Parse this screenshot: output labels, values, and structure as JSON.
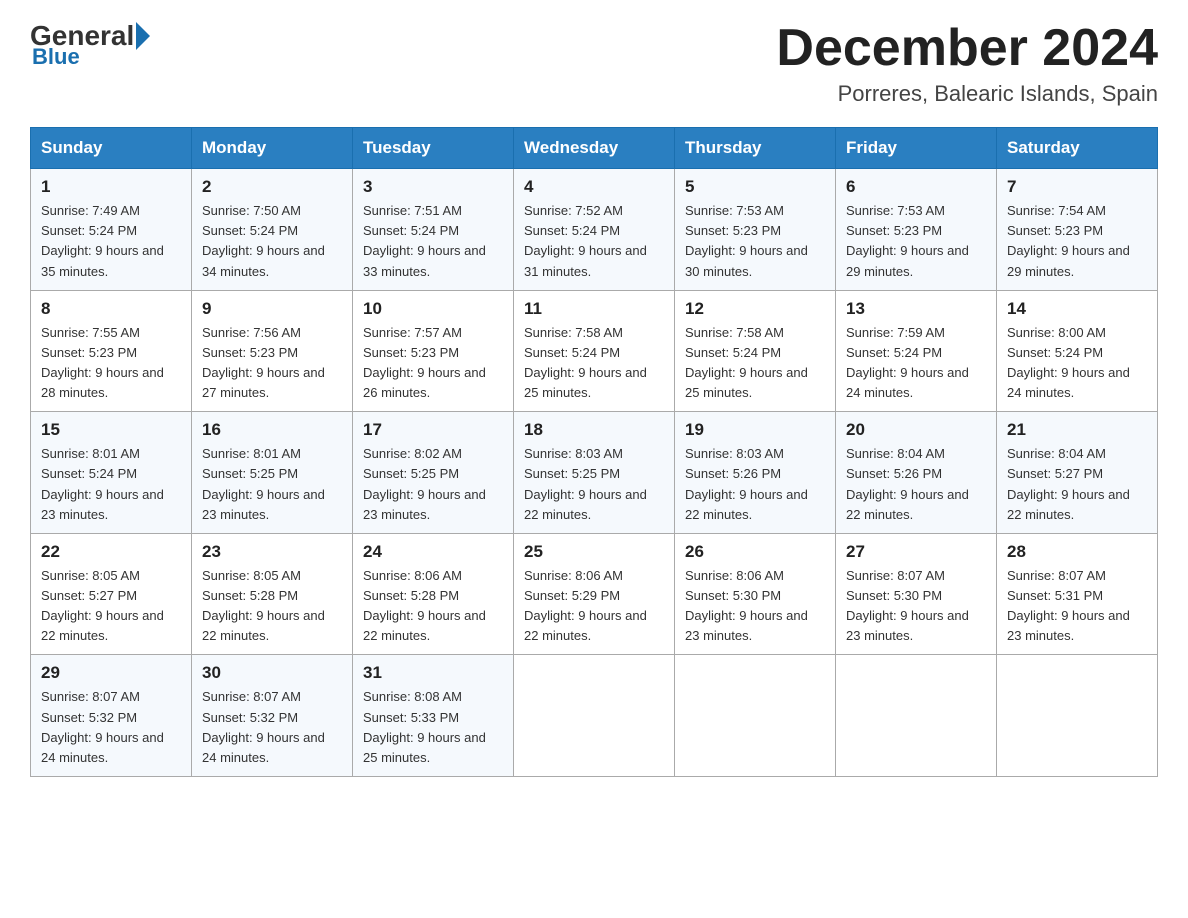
{
  "header": {
    "logo": {
      "general": "General",
      "blue": "Blue"
    },
    "title": "December 2024",
    "subtitle": "Porreres, Balearic Islands, Spain"
  },
  "days_of_week": [
    "Sunday",
    "Monday",
    "Tuesday",
    "Wednesday",
    "Thursday",
    "Friday",
    "Saturday"
  ],
  "weeks": [
    [
      {
        "day": "1",
        "sunrise": "7:49 AM",
        "sunset": "5:24 PM",
        "daylight": "9 hours and 35 minutes."
      },
      {
        "day": "2",
        "sunrise": "7:50 AM",
        "sunset": "5:24 PM",
        "daylight": "9 hours and 34 minutes."
      },
      {
        "day": "3",
        "sunrise": "7:51 AM",
        "sunset": "5:24 PM",
        "daylight": "9 hours and 33 minutes."
      },
      {
        "day": "4",
        "sunrise": "7:52 AM",
        "sunset": "5:24 PM",
        "daylight": "9 hours and 31 minutes."
      },
      {
        "day": "5",
        "sunrise": "7:53 AM",
        "sunset": "5:23 PM",
        "daylight": "9 hours and 30 minutes."
      },
      {
        "day": "6",
        "sunrise": "7:53 AM",
        "sunset": "5:23 PM",
        "daylight": "9 hours and 29 minutes."
      },
      {
        "day": "7",
        "sunrise": "7:54 AM",
        "sunset": "5:23 PM",
        "daylight": "9 hours and 29 minutes."
      }
    ],
    [
      {
        "day": "8",
        "sunrise": "7:55 AM",
        "sunset": "5:23 PM",
        "daylight": "9 hours and 28 minutes."
      },
      {
        "day": "9",
        "sunrise": "7:56 AM",
        "sunset": "5:23 PM",
        "daylight": "9 hours and 27 minutes."
      },
      {
        "day": "10",
        "sunrise": "7:57 AM",
        "sunset": "5:23 PM",
        "daylight": "9 hours and 26 minutes."
      },
      {
        "day": "11",
        "sunrise": "7:58 AM",
        "sunset": "5:24 PM",
        "daylight": "9 hours and 25 minutes."
      },
      {
        "day": "12",
        "sunrise": "7:58 AM",
        "sunset": "5:24 PM",
        "daylight": "9 hours and 25 minutes."
      },
      {
        "day": "13",
        "sunrise": "7:59 AM",
        "sunset": "5:24 PM",
        "daylight": "9 hours and 24 minutes."
      },
      {
        "day": "14",
        "sunrise": "8:00 AM",
        "sunset": "5:24 PM",
        "daylight": "9 hours and 24 minutes."
      }
    ],
    [
      {
        "day": "15",
        "sunrise": "8:01 AM",
        "sunset": "5:24 PM",
        "daylight": "9 hours and 23 minutes."
      },
      {
        "day": "16",
        "sunrise": "8:01 AM",
        "sunset": "5:25 PM",
        "daylight": "9 hours and 23 minutes."
      },
      {
        "day": "17",
        "sunrise": "8:02 AM",
        "sunset": "5:25 PM",
        "daylight": "9 hours and 23 minutes."
      },
      {
        "day": "18",
        "sunrise": "8:03 AM",
        "sunset": "5:25 PM",
        "daylight": "9 hours and 22 minutes."
      },
      {
        "day": "19",
        "sunrise": "8:03 AM",
        "sunset": "5:26 PM",
        "daylight": "9 hours and 22 minutes."
      },
      {
        "day": "20",
        "sunrise": "8:04 AM",
        "sunset": "5:26 PM",
        "daylight": "9 hours and 22 minutes."
      },
      {
        "day": "21",
        "sunrise": "8:04 AM",
        "sunset": "5:27 PM",
        "daylight": "9 hours and 22 minutes."
      }
    ],
    [
      {
        "day": "22",
        "sunrise": "8:05 AM",
        "sunset": "5:27 PM",
        "daylight": "9 hours and 22 minutes."
      },
      {
        "day": "23",
        "sunrise": "8:05 AM",
        "sunset": "5:28 PM",
        "daylight": "9 hours and 22 minutes."
      },
      {
        "day": "24",
        "sunrise": "8:06 AM",
        "sunset": "5:28 PM",
        "daylight": "9 hours and 22 minutes."
      },
      {
        "day": "25",
        "sunrise": "8:06 AM",
        "sunset": "5:29 PM",
        "daylight": "9 hours and 22 minutes."
      },
      {
        "day": "26",
        "sunrise": "8:06 AM",
        "sunset": "5:30 PM",
        "daylight": "9 hours and 23 minutes."
      },
      {
        "day": "27",
        "sunrise": "8:07 AM",
        "sunset": "5:30 PM",
        "daylight": "9 hours and 23 minutes."
      },
      {
        "day": "28",
        "sunrise": "8:07 AM",
        "sunset": "5:31 PM",
        "daylight": "9 hours and 23 minutes."
      }
    ],
    [
      {
        "day": "29",
        "sunrise": "8:07 AM",
        "sunset": "5:32 PM",
        "daylight": "9 hours and 24 minutes."
      },
      {
        "day": "30",
        "sunrise": "8:07 AM",
        "sunset": "5:32 PM",
        "daylight": "9 hours and 24 minutes."
      },
      {
        "day": "31",
        "sunrise": "8:08 AM",
        "sunset": "5:33 PM",
        "daylight": "9 hours and 25 minutes."
      },
      null,
      null,
      null,
      null
    ]
  ]
}
